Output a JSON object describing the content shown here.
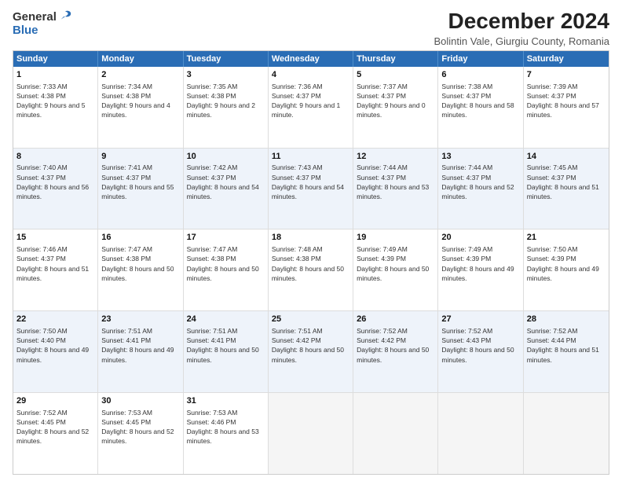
{
  "header": {
    "logo_general": "General",
    "logo_blue": "Blue",
    "title": "December 2024",
    "subtitle": "Bolintin Vale, Giurgiu County, Romania"
  },
  "days": [
    "Sunday",
    "Monday",
    "Tuesday",
    "Wednesday",
    "Thursday",
    "Friday",
    "Saturday"
  ],
  "weeks": [
    [
      {
        "day": 1,
        "sunrise": "7:33 AM",
        "sunset": "4:38 PM",
        "daylight": "9 hours and 5 minutes."
      },
      {
        "day": 2,
        "sunrise": "7:34 AM",
        "sunset": "4:38 PM",
        "daylight": "9 hours and 4 minutes."
      },
      {
        "day": 3,
        "sunrise": "7:35 AM",
        "sunset": "4:38 PM",
        "daylight": "9 hours and 2 minutes."
      },
      {
        "day": 4,
        "sunrise": "7:36 AM",
        "sunset": "4:37 PM",
        "daylight": "9 hours and 1 minute."
      },
      {
        "day": 5,
        "sunrise": "7:37 AM",
        "sunset": "4:37 PM",
        "daylight": "9 hours and 0 minutes."
      },
      {
        "day": 6,
        "sunrise": "7:38 AM",
        "sunset": "4:37 PM",
        "daylight": "8 hours and 58 minutes."
      },
      {
        "day": 7,
        "sunrise": "7:39 AM",
        "sunset": "4:37 PM",
        "daylight": "8 hours and 57 minutes."
      }
    ],
    [
      {
        "day": 8,
        "sunrise": "7:40 AM",
        "sunset": "4:37 PM",
        "daylight": "8 hours and 56 minutes."
      },
      {
        "day": 9,
        "sunrise": "7:41 AM",
        "sunset": "4:37 PM",
        "daylight": "8 hours and 55 minutes."
      },
      {
        "day": 10,
        "sunrise": "7:42 AM",
        "sunset": "4:37 PM",
        "daylight": "8 hours and 54 minutes."
      },
      {
        "day": 11,
        "sunrise": "7:43 AM",
        "sunset": "4:37 PM",
        "daylight": "8 hours and 54 minutes."
      },
      {
        "day": 12,
        "sunrise": "7:44 AM",
        "sunset": "4:37 PM",
        "daylight": "8 hours and 53 minutes."
      },
      {
        "day": 13,
        "sunrise": "7:44 AM",
        "sunset": "4:37 PM",
        "daylight": "8 hours and 52 minutes."
      },
      {
        "day": 14,
        "sunrise": "7:45 AM",
        "sunset": "4:37 PM",
        "daylight": "8 hours and 51 minutes."
      }
    ],
    [
      {
        "day": 15,
        "sunrise": "7:46 AM",
        "sunset": "4:37 PM",
        "daylight": "8 hours and 51 minutes."
      },
      {
        "day": 16,
        "sunrise": "7:47 AM",
        "sunset": "4:38 PM",
        "daylight": "8 hours and 50 minutes."
      },
      {
        "day": 17,
        "sunrise": "7:47 AM",
        "sunset": "4:38 PM",
        "daylight": "8 hours and 50 minutes."
      },
      {
        "day": 18,
        "sunrise": "7:48 AM",
        "sunset": "4:38 PM",
        "daylight": "8 hours and 50 minutes."
      },
      {
        "day": 19,
        "sunrise": "7:49 AM",
        "sunset": "4:39 PM",
        "daylight": "8 hours and 50 minutes."
      },
      {
        "day": 20,
        "sunrise": "7:49 AM",
        "sunset": "4:39 PM",
        "daylight": "8 hours and 49 minutes."
      },
      {
        "day": 21,
        "sunrise": "7:50 AM",
        "sunset": "4:39 PM",
        "daylight": "8 hours and 49 minutes."
      }
    ],
    [
      {
        "day": 22,
        "sunrise": "7:50 AM",
        "sunset": "4:40 PM",
        "daylight": "8 hours and 49 minutes."
      },
      {
        "day": 23,
        "sunrise": "7:51 AM",
        "sunset": "4:41 PM",
        "daylight": "8 hours and 49 minutes."
      },
      {
        "day": 24,
        "sunrise": "7:51 AM",
        "sunset": "4:41 PM",
        "daylight": "8 hours and 50 minutes."
      },
      {
        "day": 25,
        "sunrise": "7:51 AM",
        "sunset": "4:42 PM",
        "daylight": "8 hours and 50 minutes."
      },
      {
        "day": 26,
        "sunrise": "7:52 AM",
        "sunset": "4:42 PM",
        "daylight": "8 hours and 50 minutes."
      },
      {
        "day": 27,
        "sunrise": "7:52 AM",
        "sunset": "4:43 PM",
        "daylight": "8 hours and 50 minutes."
      },
      {
        "day": 28,
        "sunrise": "7:52 AM",
        "sunset": "4:44 PM",
        "daylight": "8 hours and 51 minutes."
      }
    ],
    [
      {
        "day": 29,
        "sunrise": "7:52 AM",
        "sunset": "4:45 PM",
        "daylight": "8 hours and 52 minutes."
      },
      {
        "day": 30,
        "sunrise": "7:53 AM",
        "sunset": "4:45 PM",
        "daylight": "8 hours and 52 minutes."
      },
      {
        "day": 31,
        "sunrise": "7:53 AM",
        "sunset": "4:46 PM",
        "daylight": "8 hours and 53 minutes."
      },
      null,
      null,
      null,
      null
    ]
  ]
}
